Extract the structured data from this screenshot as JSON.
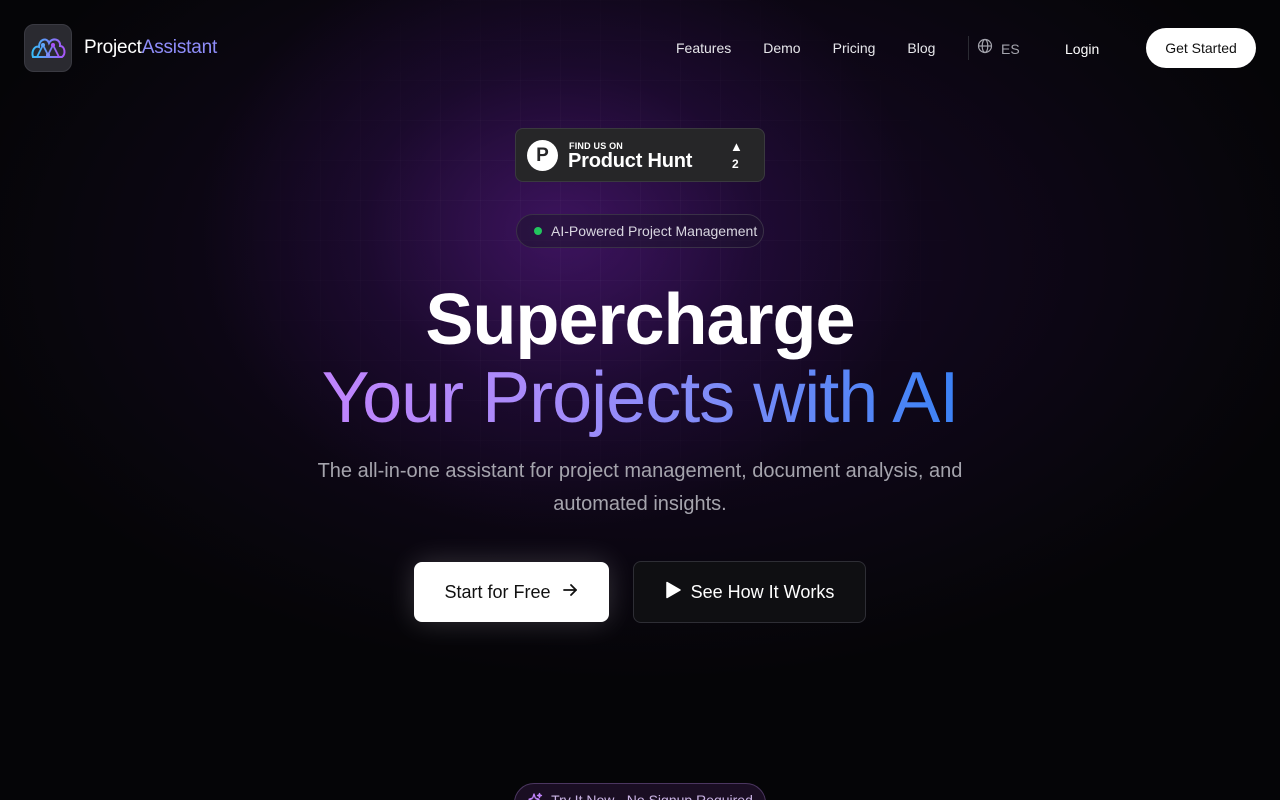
{
  "nav": {
    "brand_part1": "Project",
    "brand_part2": "Assistant",
    "links": [
      "Features",
      "Demo",
      "Pricing",
      "Blog"
    ],
    "language": "ES",
    "login": "Login",
    "get_started": "Get Started"
  },
  "product_hunt": {
    "find_us": "FIND US ON",
    "name": "Product Hunt",
    "logo_letter": "P",
    "upvote_arrow": "▲",
    "upvotes": "2"
  },
  "hero": {
    "tag": "AI-Powered Project Management",
    "title_line1": "Supercharge",
    "title_line2": "Your Projects with AI",
    "subtitle": "The all-in-one assistant for project management, document analysis, and automated insights.",
    "primary_cta": "Start for Free",
    "secondary_cta": "See How It Works"
  },
  "try_pill": "Try It Now - No Signup Required",
  "colors": {
    "background": "#050507",
    "accent_brand": "#8f8dfa",
    "gradient_start": "#c084fc",
    "gradient_end": "#3b82f6",
    "status_dot": "#22c55e"
  },
  "icons": {
    "logo": "brain-network-icon",
    "language": "globe-icon",
    "primary_cta": "arrow-right-icon",
    "secondary_cta": "play-icon",
    "try_pill": "sparkles-icon"
  }
}
